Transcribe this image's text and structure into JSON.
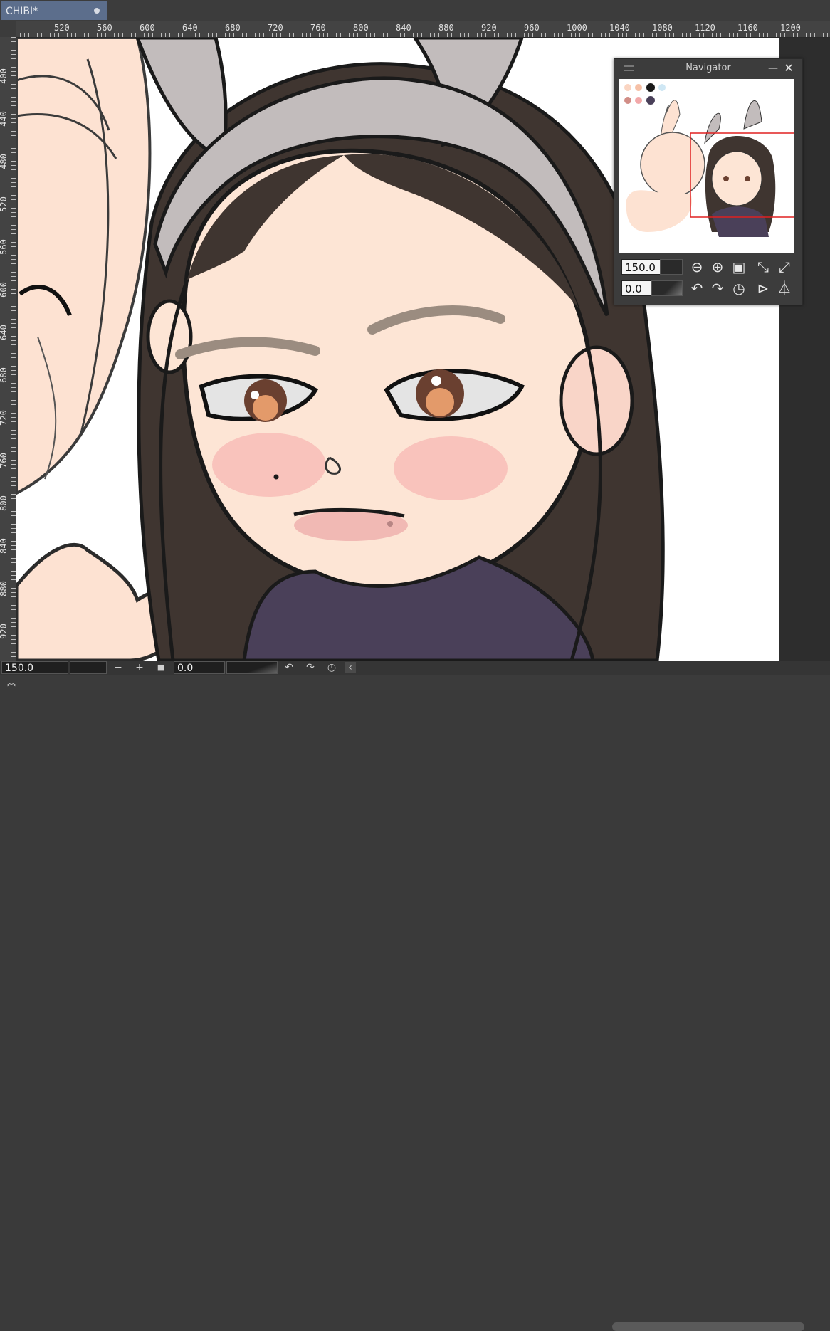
{
  "tab": {
    "title": "CHIBI*"
  },
  "ruler": {
    "top_labels": [
      "520",
      "560",
      "600",
      "640",
      "680",
      "720",
      "760",
      "800",
      "840",
      "880",
      "920",
      "960",
      "1000",
      "1040",
      "1080",
      "1120",
      "1160",
      "1200"
    ],
    "left_labels": [
      "400",
      "440",
      "480",
      "520",
      "560",
      "600",
      "640",
      "680",
      "720",
      "760",
      "800",
      "840",
      "880",
      "920"
    ]
  },
  "navigator": {
    "title": "Navigator",
    "zoom_value": "150.0",
    "rotation_value": "0.0",
    "icons": {
      "menu": "menu-icon",
      "minimize": "minimize-icon",
      "close": "close-icon",
      "zoom_out": "zoom-out-icon",
      "zoom_in": "zoom-in-icon",
      "actual_size": "actual-size-icon",
      "fit": "fit-icon",
      "fit_window": "fit-window-icon",
      "rotate_left": "rotate-left-icon",
      "rotate_right": "rotate-right-icon",
      "reset_rotation": "reset-rotation-icon",
      "flip_h": "flip-horizontal-icon",
      "flip_v": "flip-vertical-icon"
    },
    "glyphs": {
      "minimize": "—",
      "close": "✕",
      "zoom_out": "⊖",
      "zoom_in": "⊕",
      "actual_size": "▣",
      "fit": "⤡",
      "fit_window": "⤢",
      "rotate_left": "↶",
      "rotate_right": "↷",
      "reset_rotation": "◷",
      "flip_h": "⊳",
      "flip_v": "⏃"
    }
  },
  "statusbar": {
    "zoom_value": "150.0",
    "rotation_value": "0.0",
    "glyphs": {
      "zoom_out": "−",
      "zoom_in": "+",
      "actual": "■",
      "rotate_left": "↶",
      "rotate_right": "↷",
      "reset": "◷",
      "collapse": "‹",
      "expand_panel": "︽"
    }
  },
  "colors": {
    "tab_active": "#5c6e8c",
    "panel_bg": "#3c3c3c",
    "viewport_rect": "#e02020"
  }
}
